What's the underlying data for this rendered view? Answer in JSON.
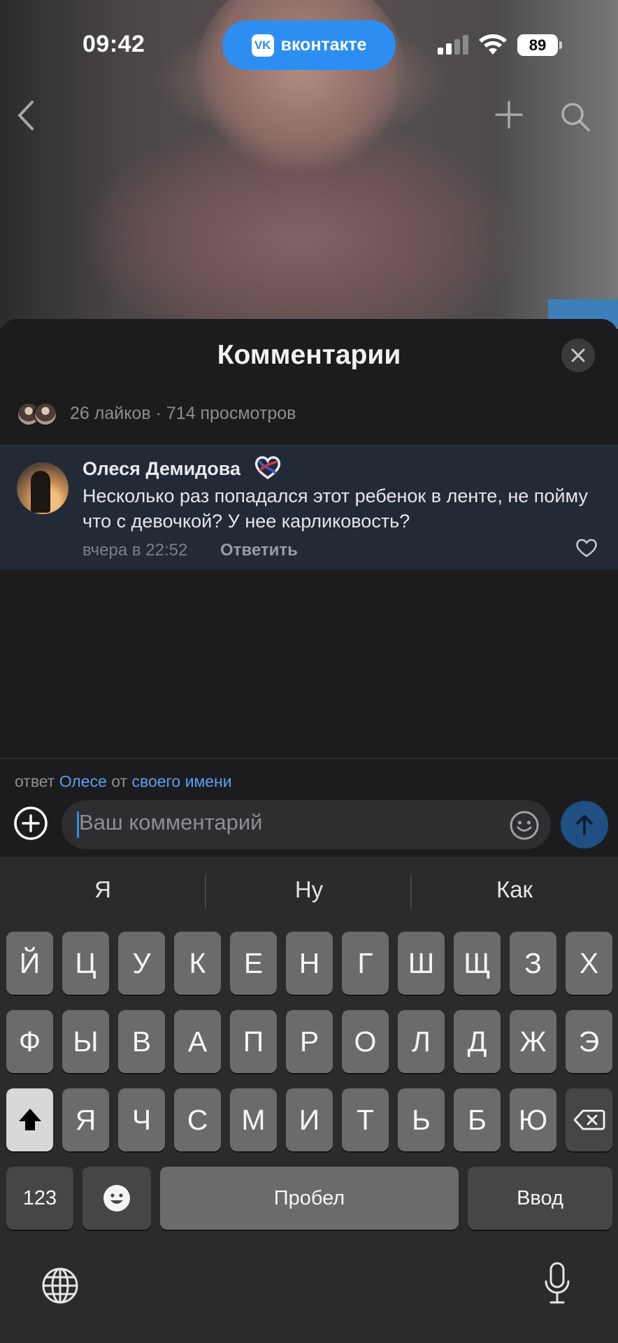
{
  "status_bar": {
    "time": "09:42",
    "app_pill_label": "вконтакте",
    "vk_logo_text": "VK",
    "battery": "89"
  },
  "comments_sheet": {
    "title": "Комментарии",
    "stats": "26 лайков · 714 просмотров",
    "comment": {
      "author": "Олеся Демидова",
      "text": "Несколько раз попадался этот ребенок в ленте, не пойму что с девочкой? У нее карликовость?",
      "timestamp": "вчера в 22:52",
      "reply_label": "Ответить"
    }
  },
  "reply_bar": {
    "prefix": "ответ",
    "recipient": "Олесе",
    "middle": "от",
    "identity": "своего имени"
  },
  "input": {
    "placeholder": "Ваш комментарий"
  },
  "keyboard": {
    "suggestions": [
      "Я",
      "Ну",
      "Как"
    ],
    "row1": [
      "Й",
      "Ц",
      "У",
      "К",
      "Е",
      "Н",
      "Г",
      "Ш",
      "Щ",
      "З",
      "Х"
    ],
    "row2": [
      "Ф",
      "Ы",
      "В",
      "А",
      "П",
      "Р",
      "О",
      "Л",
      "Д",
      "Ж",
      "Э"
    ],
    "row3": [
      "Я",
      "Ч",
      "С",
      "М",
      "И",
      "Т",
      "Ь",
      "Б",
      "Ю"
    ],
    "numbers_label": "123",
    "space_label": "Пробел",
    "return_label": "Ввод"
  },
  "colors": {
    "accent": "#2c8ef0",
    "send_button": "#1f4f83",
    "comment_highlight": "#222a36",
    "sheet_background": "#1c1c1e",
    "key": "#6b6b6e",
    "key_dark": "#464649"
  },
  "icons": {
    "back": "chevron-left-icon",
    "add_post": "plus-icon",
    "search": "search-icon",
    "close": "close-icon",
    "like": "heart-outline-icon",
    "badge": "heart-ribbon-icon",
    "attach": "plus-circle-icon",
    "emoji": "smiley-icon",
    "send": "arrow-up-icon",
    "shift": "shift-icon",
    "backspace": "backspace-icon",
    "emoji_key": "emoji-face-icon",
    "globe": "globe-icon",
    "mic": "microphone-icon"
  }
}
